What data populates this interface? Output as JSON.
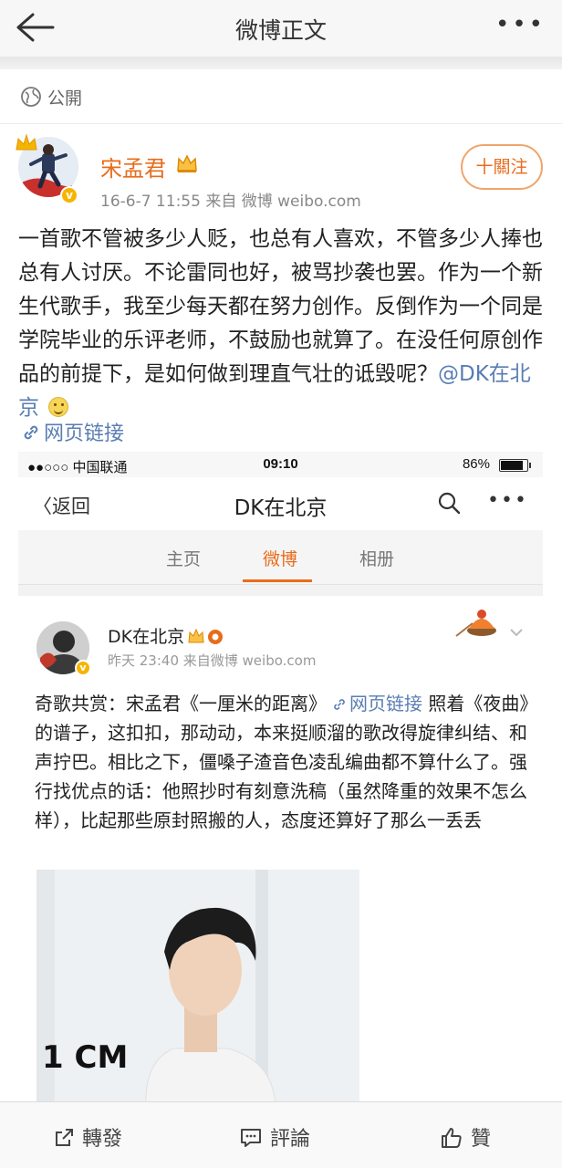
{
  "nav": {
    "title": "微博正文",
    "more": "•••"
  },
  "visibility": {
    "label": "公開"
  },
  "author": {
    "name": "宋孟君",
    "badge": "v",
    "meta": "16-6-7 11:55  来自 微博 weibo.com",
    "follow_label": "十關注"
  },
  "post": {
    "text_before": "一首歌不管被多少人贬，也总有人喜欢，不管多少人捧也总有人讨厌。不论雷同也好，被骂抄袭也罢。作为一个新生代歌手，我至少每天都在努力创作。反倒作为一个同是学院毕业的乐评老师，不鼓励也就算了。在没任何原创作品的前提下，是如何做到理直气壮的诋毁呢？",
    "mention": "@DK在北京",
    "link_label": "网页链接"
  },
  "embed": {
    "status": {
      "signal": "●●○○○ 中国联通",
      "time": "09:10",
      "battery": "86%",
      "battery_level": 0.86
    },
    "nav": {
      "back_label": "〈返回",
      "title": "DK在北京",
      "more": "•••"
    },
    "tabs": [
      {
        "label": "主页"
      },
      {
        "label": "微博"
      },
      {
        "label": "相册"
      }
    ],
    "active_tab": 1,
    "author": {
      "name": "DK在北京",
      "badge": "v",
      "meta": "昨天 23:40  来自微博 weibo.com"
    },
    "text": {
      "part1": "奇歌共赏：宋孟君《一厘米的距离》",
      "link": "网页链接",
      "part2": "照着《夜曲》的谱子，这扣扣，那动动，本来挺顺溜的歌改得旋律纠结、和声拧巴。相比之下，僵嗓子渣音色凌乱编曲都不算什么了。强行找优点的话：他照抄时有刻意洗稿（虽然降重的效果不怎么样），比起那些原封照搬的人，态度还算好了那么一丢丢"
    },
    "photo_text": "1 CM"
  },
  "bottom_bar": {
    "repost": "轉發",
    "comment": "評論",
    "like": "贊"
  },
  "colors": {
    "accent": "#e86c1b",
    "link": "#5a7db3"
  }
}
